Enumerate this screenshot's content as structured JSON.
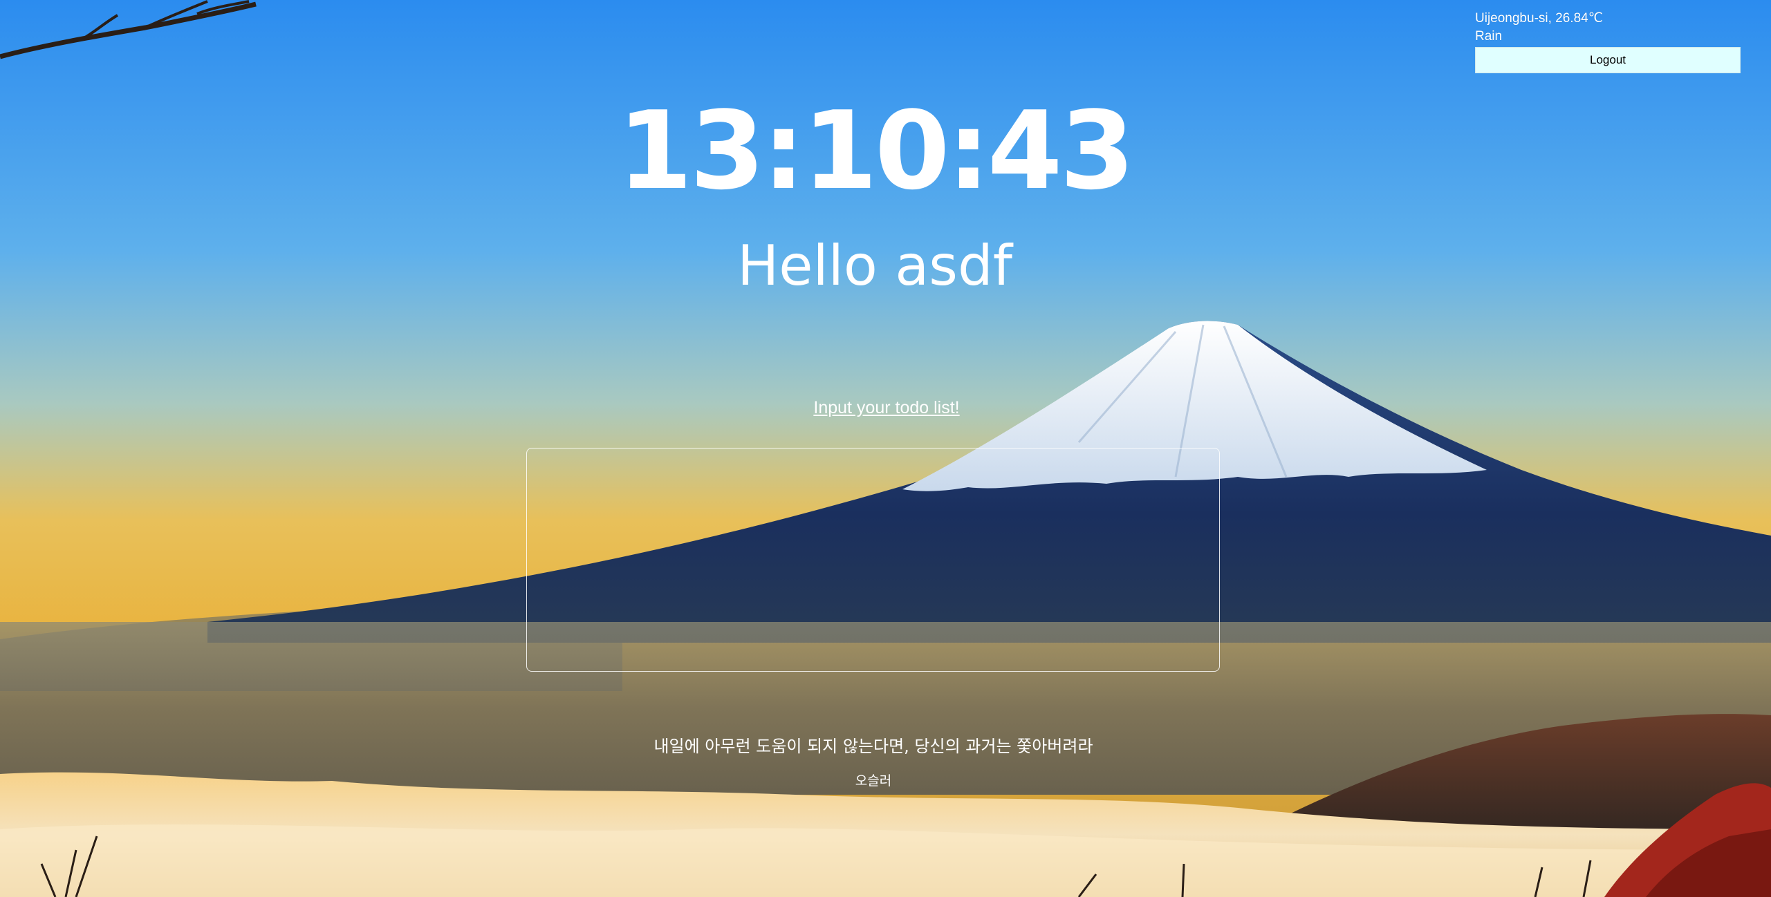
{
  "weather": {
    "location_temp": "Uijeongbu-si, 26.84℃",
    "condition": "Rain"
  },
  "account": {
    "logout_label": "Logout"
  },
  "clock": {
    "time": "13:10:43"
  },
  "greeting": {
    "text": "Hello asdf"
  },
  "todo": {
    "prompt": "Input your todo list!"
  },
  "quote": {
    "text": "내일에 아무런 도움이 되지 않는다면, 당신의 과거는 쫓아버려라",
    "author": "오슬러"
  },
  "colors": {
    "sky_top": "#2f8ff0",
    "sky_horizon": "#f2c04a",
    "mountain": "#1c3566",
    "snow": "#eef4fb",
    "logout_bg": "#e0ffff"
  }
}
